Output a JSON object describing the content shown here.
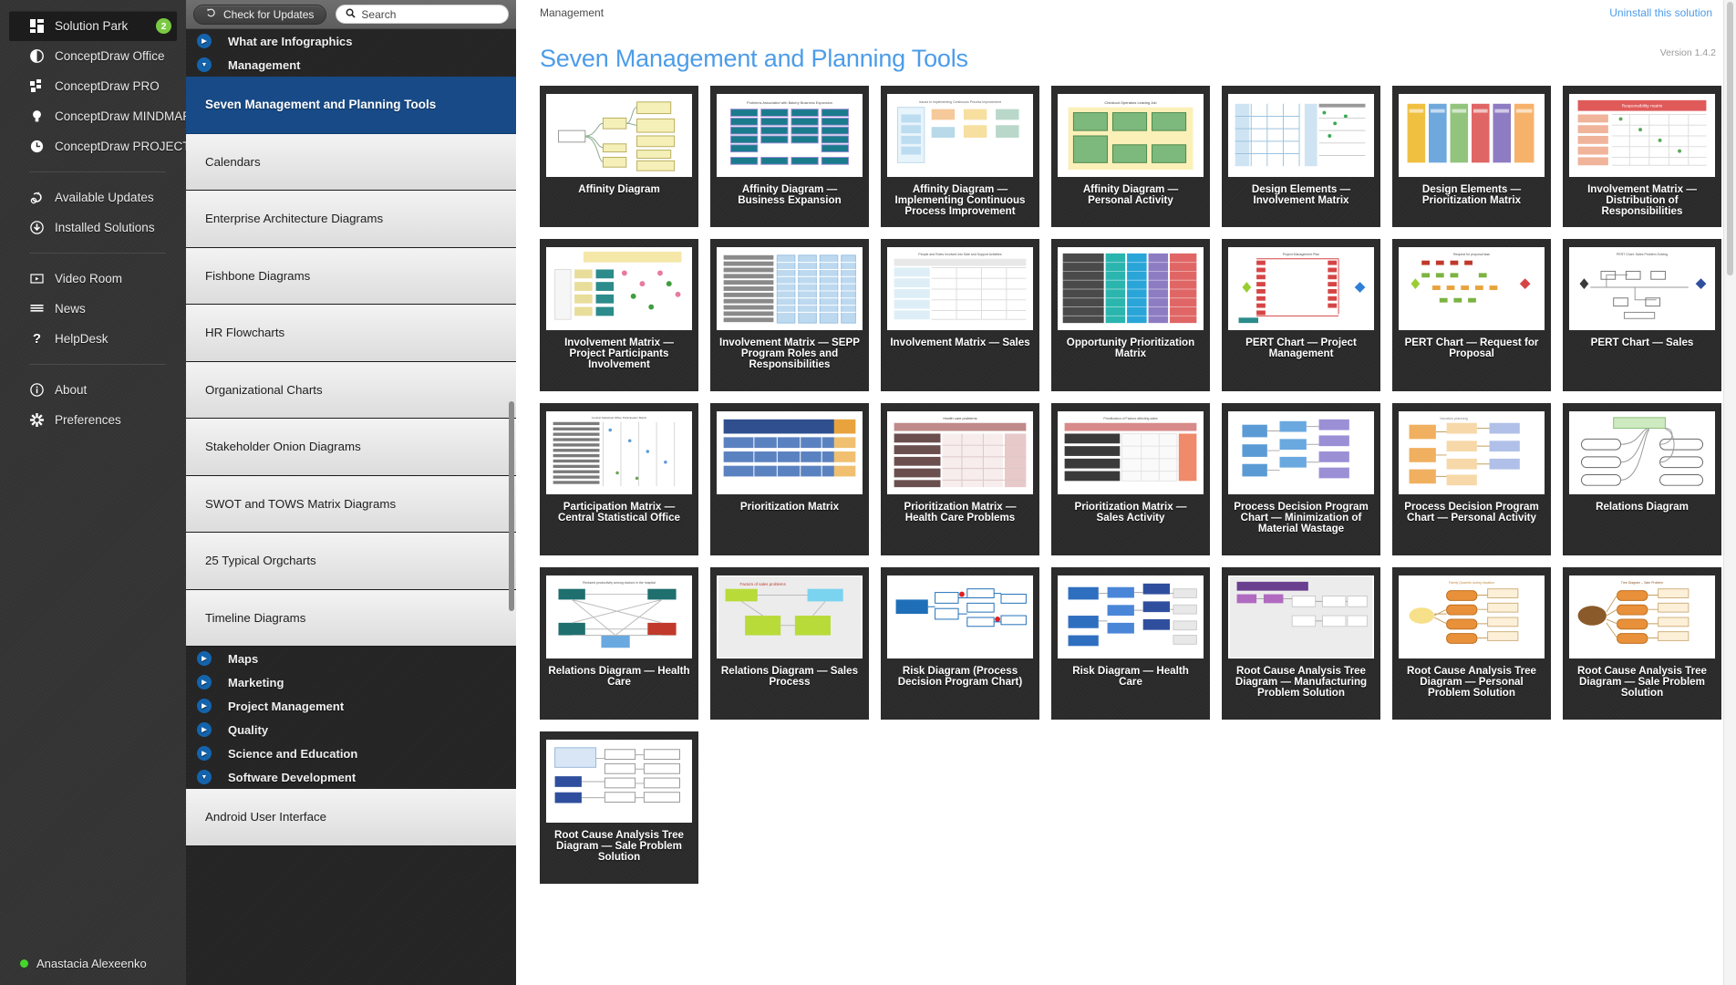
{
  "sidebar": {
    "items": [
      {
        "label": "Solution Park",
        "icon": "grid-icon",
        "badge": "2",
        "active": true
      },
      {
        "label": "ConceptDraw Office",
        "icon": "half-circle-icon",
        "badge": "",
        "active": false
      },
      {
        "label": "ConceptDraw PRO",
        "icon": "shapes-icon",
        "badge": "",
        "active": false
      },
      {
        "label": "ConceptDraw MINDMAP",
        "icon": "bulb-icon",
        "badge": "",
        "active": false
      },
      {
        "label": "ConceptDraw PROJECT",
        "icon": "clock-icon",
        "badge": "",
        "active": false
      },
      {
        "label": "Available Updates",
        "icon": "refresh-icon",
        "badge": "",
        "active": false
      },
      {
        "label": "Installed Solutions",
        "icon": "download-icon",
        "badge": "",
        "active": false
      },
      {
        "label": "Video Room",
        "icon": "play-box-icon",
        "badge": "",
        "active": false
      },
      {
        "label": "News",
        "icon": "list-lines-icon",
        "badge": "",
        "active": false
      },
      {
        "label": "HelpDesk",
        "icon": "question-icon",
        "badge": "",
        "active": false
      },
      {
        "label": "About",
        "icon": "info-icon",
        "badge": "",
        "active": false
      },
      {
        "label": "Preferences",
        "icon": "gear-icon",
        "badge": "",
        "active": false
      }
    ],
    "user": {
      "name": "Anastacia Alexeenko",
      "status": "online"
    }
  },
  "toolbar": {
    "check_updates_label": "Check for Updates",
    "check_updates_icon": "refresh-icon",
    "search_icon": "search-icon",
    "search_placeholder": "Search",
    "search_value": ""
  },
  "nav": {
    "top_categories": [
      {
        "label": "What are Infographics",
        "state": "collapsed"
      },
      {
        "label": "Management",
        "state": "expanded"
      }
    ],
    "solutions": [
      {
        "label": "Seven Management and Planning Tools",
        "selected": true
      },
      {
        "label": "Calendars",
        "selected": false
      },
      {
        "label": "Enterprise Architecture Diagrams",
        "selected": false
      },
      {
        "label": "Fishbone Diagrams",
        "selected": false
      },
      {
        "label": "HR Flowcharts",
        "selected": false
      },
      {
        "label": "Organizational Charts",
        "selected": false
      },
      {
        "label": "Stakeholder Onion Diagrams",
        "selected": false
      },
      {
        "label": "SWOT and TOWS Matrix Diagrams",
        "selected": false
      },
      {
        "label": "25 Typical Orgcharts",
        "selected": false
      },
      {
        "label": "Timeline Diagrams",
        "selected": false
      }
    ],
    "bottom_categories": [
      {
        "label": "Maps",
        "state": "collapsed"
      },
      {
        "label": "Marketing",
        "state": "collapsed"
      },
      {
        "label": "Project Management",
        "state": "collapsed"
      },
      {
        "label": "Quality",
        "state": "collapsed"
      },
      {
        "label": "Science and Education",
        "state": "collapsed"
      },
      {
        "label": "Software Development",
        "state": "expanded"
      }
    ],
    "after_solutions": [
      {
        "label": "Android User Interface",
        "selected": false
      }
    ]
  },
  "main": {
    "breadcrumb": "Management",
    "uninstall_label": "Uninstall this solution",
    "title": "Seven Management and Planning Tools",
    "version": "Version 1.4.2",
    "accent_color": "#4d9ce8",
    "selected_color": "#174a86",
    "templates": [
      {
        "label": "Affinity Diagram",
        "thumb": "mindmap-yellow"
      },
      {
        "label": "Affinity Diagram — Business Expansion",
        "thumb": "affinity-teal"
      },
      {
        "label": "Affinity Diagram — Implementing Continuous Process Improvement",
        "thumb": "affinity-pastel"
      },
      {
        "label": "Affinity Diagram — Personal Activity",
        "thumb": "affinity-green"
      },
      {
        "label": "Design Elements — Involvement Matrix",
        "thumb": "matrix-blue"
      },
      {
        "label": "Design Elements — Prioritization Matrix",
        "thumb": "matrix-colorbars"
      },
      {
        "label": "Involvement Matrix — Distribution of Responsibilities",
        "thumb": "matrix-red-header"
      },
      {
        "label": "Involvement Matrix — Project Participants Involvement",
        "thumb": "matrix-icons"
      },
      {
        "label": "Involvement Matrix — SEPP Program Roles and Responsibilities",
        "thumb": "matrix-grey-rows"
      },
      {
        "label": "Involvement Matrix — Sales",
        "thumb": "matrix-table"
      },
      {
        "label": "Opportunity Prioritization Matrix",
        "thumb": "matrix-rainbow"
      },
      {
        "label": "PERT Chart — Project Management",
        "thumb": "pert-red"
      },
      {
        "label": "PERT Chart — Request for Proposal",
        "thumb": "pert-green"
      },
      {
        "label": "PERT Chart — Sales",
        "thumb": "pert-line"
      },
      {
        "label": "Participation Matrix — Central Statistical Office",
        "thumb": "matrix-participation"
      },
      {
        "label": "Prioritization Matrix",
        "thumb": "table-blue"
      },
      {
        "label": "Prioritization Matrix — Health Care Problems",
        "thumb": "table-pink"
      },
      {
        "label": "Prioritization Matrix — Sales Activity",
        "thumb": "table-salmon"
      },
      {
        "label": "Process Decision Program Chart — Minimization of Material Wastage",
        "thumb": "pdpc-purple"
      },
      {
        "label": "Process Decision Program Chart — Personal Activity",
        "thumb": "pdpc-orange"
      },
      {
        "label": "Relations Diagram",
        "thumb": "relations-grey"
      },
      {
        "label": "Relations Diagram — Health Care",
        "thumb": "relations-health"
      },
      {
        "label": "Relations Diagram — Sales Process",
        "thumb": "relations-green"
      },
      {
        "label": "Risk Diagram (Process Decision Program Chart)",
        "thumb": "risk-blue"
      },
      {
        "label": "Risk Diagram — Health Care",
        "thumb": "risk-health"
      },
      {
        "label": "Root Cause Analysis Tree Diagram — Manufacturing Problem Solution",
        "thumb": "rca-purple"
      },
      {
        "label": "Root Cause Analysis Tree Diagram — Personal Problem Solution",
        "thumb": "rca-orange"
      },
      {
        "label": "Root Cause Analysis Tree Diagram — Sale Problem Solution",
        "thumb": "rca-brown"
      },
      {
        "label": "Root Cause Analysis Tree Diagram — Sale Problem Solution",
        "thumb": "rca-blue"
      }
    ]
  }
}
